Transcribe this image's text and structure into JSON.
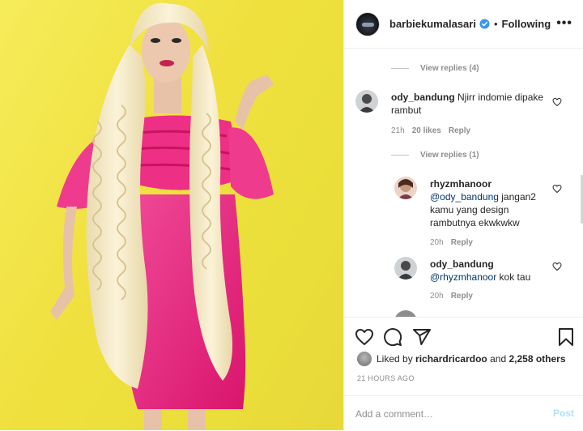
{
  "header": {
    "username": "barbiekumalasari",
    "separator": "•",
    "follow_status": "Following",
    "more": "•••"
  },
  "comments": {
    "view_replies_1": "View replies (4)",
    "comment1": {
      "username": "ody_bandung",
      "text": "Njirr indomie dipake rambut",
      "time": "21h",
      "likes": "20 likes",
      "reply": "Reply"
    },
    "view_replies_2": "View replies (1)",
    "reply1": {
      "username": "rhyzmhanoor",
      "mention": "@ody_bandung",
      "text": " jangan2 kamu yang design rambutnya ekwkwkw",
      "time": "20h",
      "reply": "Reply"
    },
    "reply2": {
      "username": "ody_bandung",
      "mention": "@rhyzmhanoor",
      "text": " kok tau",
      "time": "20h",
      "reply": "Reply"
    }
  },
  "likes": {
    "prefix": "Liked by ",
    "user": "richardricardoo",
    "middle": " and ",
    "others": "2,258 others"
  },
  "timeago": "21 HOURS AGO",
  "add_comment": {
    "placeholder": "Add a comment…",
    "post_label": "Post"
  },
  "icons": {
    "heart": "heart-icon",
    "comment": "comment-icon",
    "share": "share-icon",
    "save": "bookmark-icon",
    "verified": "verified-badge-icon"
  },
  "colors": {
    "verified": "#3897f0",
    "link": "#00376b",
    "muted": "#8e8e8e",
    "post_disabled": "#b2dffc",
    "photo_background": "#f0e03e",
    "dress": "#e8207a",
    "hair": "#f3e6bf"
  }
}
